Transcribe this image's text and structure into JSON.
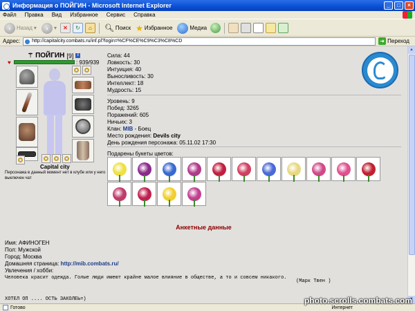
{
  "window": {
    "title": "Информация о ПОЙГИН - Microsoft Internet Explorer",
    "controls": [
      "_",
      "□",
      "×"
    ]
  },
  "menu": [
    "Файл",
    "Правка",
    "Вид",
    "Избранное",
    "Сервис",
    "Справка"
  ],
  "toolbar": {
    "back": "Назад",
    "search": "Поиск",
    "favorites": "Избранное",
    "media": "Медиа"
  },
  "address": {
    "label": "Адрес:",
    "url": "http://capitalcity.combats.ru/inf.pl?login=%CF%CE%C9%C3%C8%CD",
    "go": "Переход"
  },
  "character": {
    "nick": "ПОЙГИН",
    "level": "[9]",
    "hp": ": 939/939",
    "hp_fraction": 1.0,
    "city": "Capital city",
    "chat_status": "Персонажа в данный момент нет в клубе или у него выключен чат"
  },
  "stats": {
    "strength": "Сила: 44",
    "agility": "Ловкость: 30",
    "intuition": "Интуиция: 40",
    "endurance": "Выносливость: 30",
    "intellect": "Интеллект: 18",
    "wisdom": "Мудрость: 15"
  },
  "record": {
    "level": "Уровень: 9",
    "wins": "Побед: 3265",
    "losses": "Поражений: 605",
    "draws": "Ничьих: 3",
    "clan_label": "Клан:",
    "clan_name": "MIB",
    "clan_rank": "- Боец",
    "birthplace_label": "Место рождения:",
    "birthplace": "Devils city",
    "birthday": "День рождения персонажа: 05.11.02 17:30"
  },
  "flowers": {
    "title": "Подарены букеты цветов:",
    "colors": [
      "#f0e040",
      "#8a2a8a",
      "#3a6ad0",
      "#b03a8a",
      "#c02040",
      "#d04060",
      "#4a6ad8",
      "#e8d880",
      "#d04a8a",
      "#e05090",
      "#c02030",
      "#c03a6a",
      "#c02050",
      "#f0d030",
      "#c04090"
    ]
  },
  "profile": {
    "section_title": "Анкетные данные",
    "name": "Имя: АФИНОГЕН",
    "gender": "Пол: Мужской",
    "city": "Город: Москва",
    "homepage_label": "Домашняя страница:",
    "homepage": "http://mib.combats.ru/",
    "hobbies": "Увлечения / хобби:",
    "quote": "Человека красит одежда. Голые люди имеют крайне малое влияние в обществе, а то и совсем никакого.",
    "author": "(Марк Твен )",
    "cut_text": "ХОТЕЛ ОП   .... ОСТЬ ЗАКОЛЕЬ=)"
  },
  "status": {
    "text": "Готово",
    "zone": "Интернет",
    "watermark": "photo.scrolls.combats.com"
  }
}
